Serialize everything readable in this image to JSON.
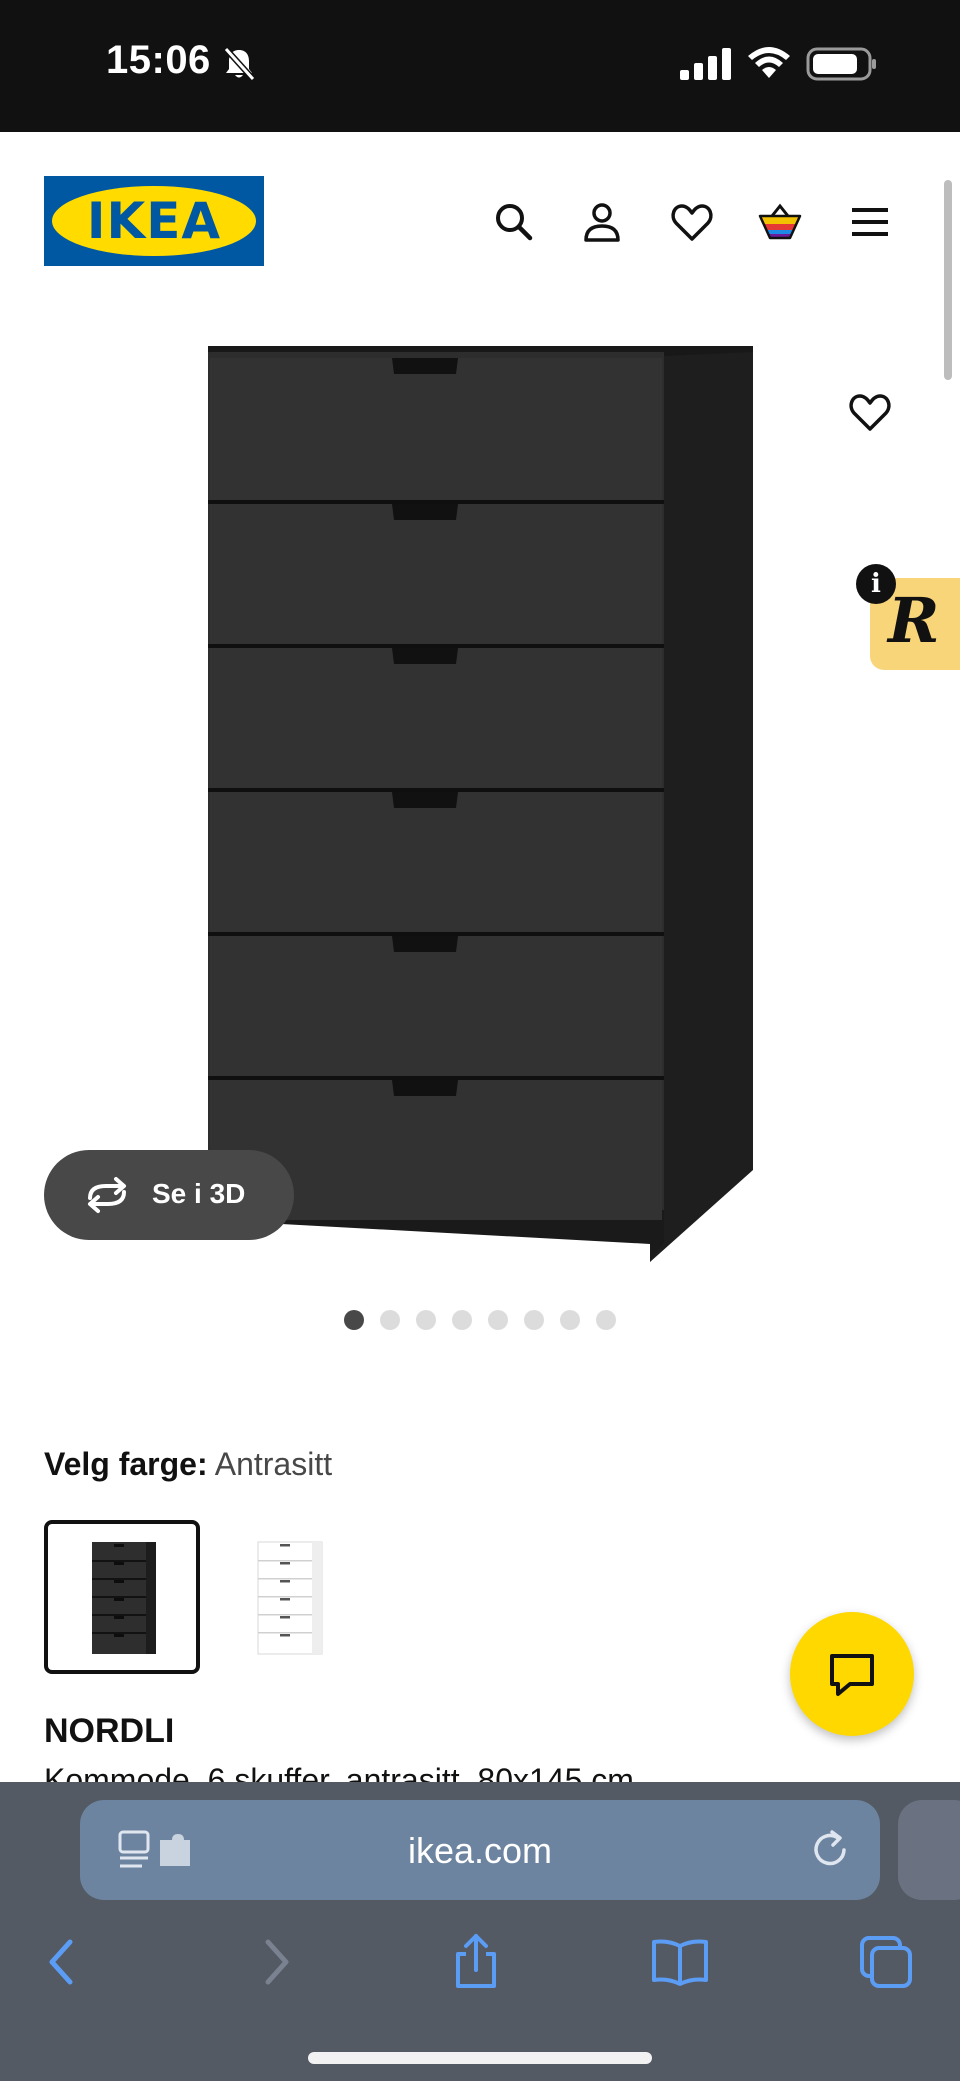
{
  "status_bar": {
    "time": "15:06",
    "icons": [
      "bell-slash-icon",
      "signal-icon",
      "wifi-icon",
      "battery-icon"
    ]
  },
  "header": {
    "logo_text": "IKEA",
    "icons": [
      "search-icon",
      "account-icon",
      "heart-icon",
      "cart-icon",
      "menu-icon"
    ]
  },
  "product_media": {
    "view_3d_label": "Se i 3D",
    "carousel_total": 8,
    "carousel_active": 1
  },
  "color_selection": {
    "label": "Velg farge:",
    "value": "Antrasitt",
    "options": [
      "dark-chest-swatch",
      "white-chest-swatch"
    ],
    "selected": 0
  },
  "product": {
    "name": "NORDLI",
    "description": "Kommode, 6 skuffer, antrasitt, 80x145 cm"
  },
  "browser": {
    "url": "ikea.com",
    "toolbar_icons": [
      "back-icon",
      "forward-icon",
      "share-icon",
      "bookmarks-icon",
      "tabs-icon"
    ]
  },
  "colors": {
    "status_bar_bg": "#111111",
    "brand_blue": "#0058a3",
    "brand_yellow": "#ffdb00",
    "chat_button": "#ffd800",
    "browser_bar_bg": "#545a64",
    "address_bar_bg": "#6c84a0",
    "browser_icon_blue": "#5b9cf5"
  }
}
